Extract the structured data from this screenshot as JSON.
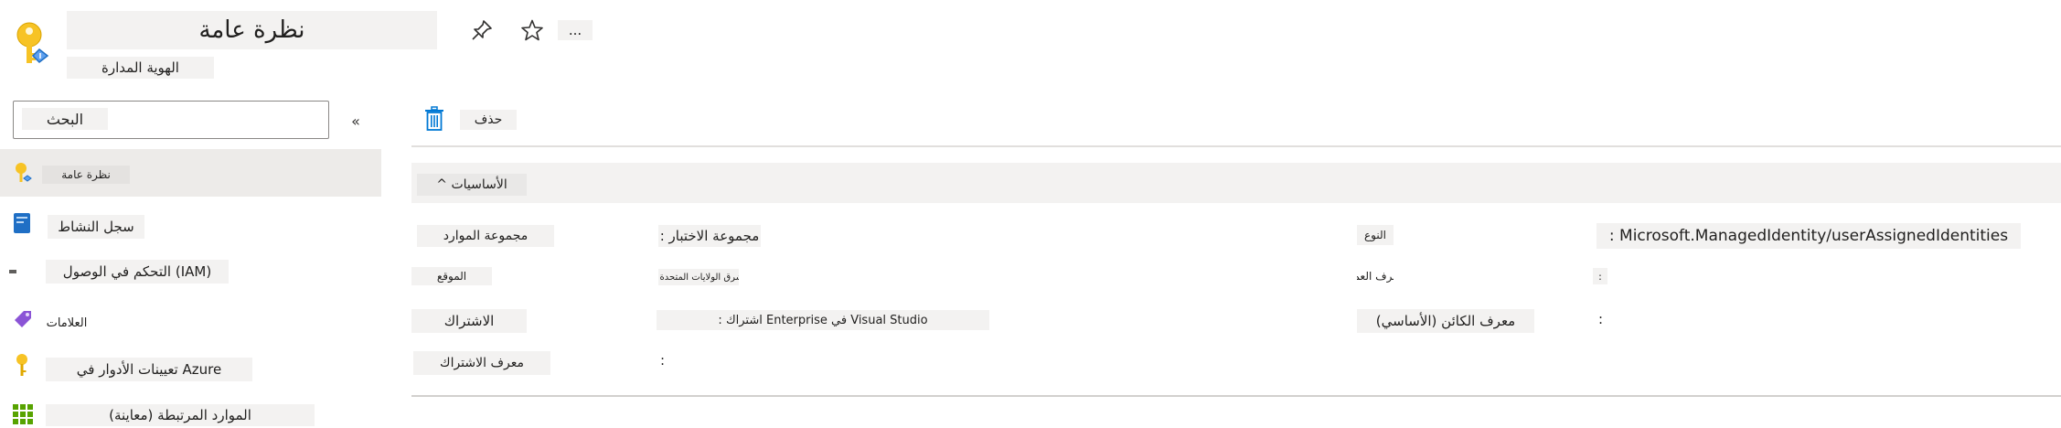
{
  "header": {
    "title": "نظرة عامة",
    "subtitle": "الهوية المدارة",
    "more_label": "...",
    "icons": [
      "managed-identity-icon",
      "pin-icon",
      "star-icon"
    ]
  },
  "sidebar": {
    "search_label": "البحث",
    "collapse_label": "«",
    "items": [
      {
        "label": "نظرة عامة",
        "icon": "managed-identity-icon",
        "selected": true
      },
      {
        "label": "سجل النشاط",
        "icon": "activity-log-icon"
      },
      {
        "label": "التحكم في الوصول (IAM)",
        "icon": "iam-icon"
      },
      {
        "label": "العلامات",
        "icon": "tag-icon"
      },
      {
        "label": "تعيينات الأدوار في Azure",
        "icon": "key-icon"
      },
      {
        "label": "الموارد المرتبطة (معاينة)",
        "icon": "grid-icon"
      }
    ]
  },
  "toolbar": {
    "delete_label": "حذف"
  },
  "essentials": {
    "toggle_label": "^ الأساسيات",
    "left": [
      {
        "label": "مجموعة الموارد",
        "value": ": مجموعة الاختبار"
      },
      {
        "label": "الموقع",
        "value": ": شرق الولايات المتحدة"
      },
      {
        "label": "الاشتراك",
        "value": ": اشتراك Enterprise في Visual Studio"
      },
      {
        "label": "معرف الاشتراك",
        "value": ":"
      }
    ],
    "right": [
      {
        "label": "النوع",
        "value": ": Microsoft.ManagedIdentity/userAssignedIdentities"
      },
      {
        "label": "معرف العميل)",
        "value": ":"
      },
      {
        "label": "معرف الكائن (الأساسي)",
        "value": ":"
      }
    ]
  },
  "colors": {
    "accent": "#0078d4",
    "selected_bg": "#edebe9",
    "label_bg": "#f3f2f1"
  }
}
